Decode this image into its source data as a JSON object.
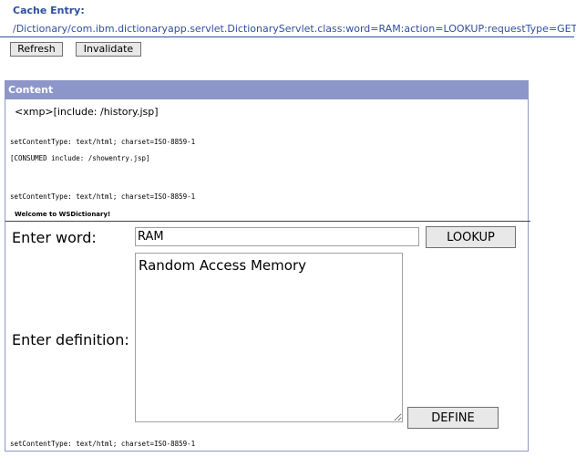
{
  "cache": {
    "label": "Cache Entry:",
    "path": "/Dictionary/com.ibm.dictionaryapp.servlet.DictionaryServlet.class:word=RAM:action=LOOKUP:requestType=GET"
  },
  "toolbar": {
    "refresh_label": "Refresh",
    "invalidate_label": "Invalidate"
  },
  "content": {
    "header": "Content",
    "xmp_line": "<xmp>[include: /history.jsp]",
    "set_content_type_1": "setContentType: text/html; charset=ISO-8859-1",
    "consumed_include": "[CONSUMED include: /showentry.jsp]",
    "set_content_type_2": "setContentType: text/html; charset=ISO-8859-1",
    "welcome": "Welcome to WSDictionary!",
    "form": {
      "word_label": "Enter word:",
      "word_value": "RAM",
      "lookup_label": "LOOKUP",
      "definition_label": "Enter definition:",
      "definition_value": "Random Access Memory",
      "define_label": "DEFINE"
    },
    "set_content_type_3": "setContentType: text/html; charset=ISO-8859-1"
  }
}
